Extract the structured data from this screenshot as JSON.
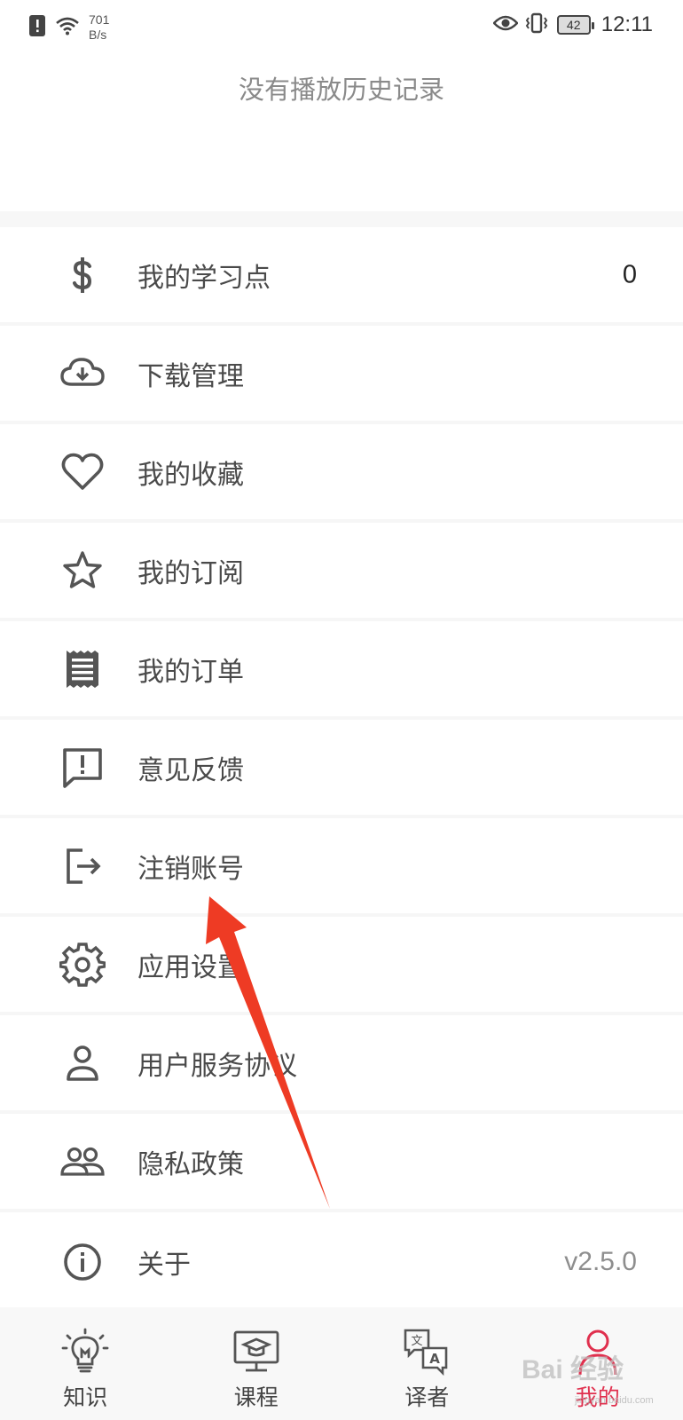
{
  "status_bar": {
    "net_speed_value": "701",
    "net_speed_unit": "B/s",
    "battery": "42",
    "time": "12:11"
  },
  "history": {
    "empty_text": "没有播放历史记录"
  },
  "menu": {
    "items": [
      {
        "label": "我的学习点",
        "value": "0",
        "icon": "dollar-icon"
      },
      {
        "label": "下载管理",
        "icon": "cloud-download-icon"
      },
      {
        "label": "我的收藏",
        "icon": "heart-icon"
      },
      {
        "label": "我的订阅",
        "icon": "star-icon"
      },
      {
        "label": "我的订单",
        "icon": "receipt-icon"
      },
      {
        "label": "意见反馈",
        "icon": "feedback-icon"
      },
      {
        "label": "注销账号",
        "icon": "logout-icon"
      },
      {
        "label": "应用设置",
        "icon": "gear-icon"
      },
      {
        "label": "用户服务协议",
        "icon": "person-icon"
      },
      {
        "label": "隐私政策",
        "icon": "people-icon"
      },
      {
        "label": "关于",
        "value": "v2.5.0",
        "icon": "info-icon"
      }
    ]
  },
  "tabs": [
    {
      "label": "知识",
      "icon": "lightbulb-icon"
    },
    {
      "label": "课程",
      "icon": "monitor-course-icon"
    },
    {
      "label": "译者",
      "icon": "translate-icon"
    },
    {
      "label": "我的",
      "icon": "person-icon",
      "active": true
    }
  ],
  "colors": {
    "accent": "#e0304e",
    "annotation_arrow": "#ee3b24",
    "icon": "#555555"
  },
  "watermark": {
    "text": "Bai 经验",
    "sub": "jingyan.baidu.com"
  }
}
